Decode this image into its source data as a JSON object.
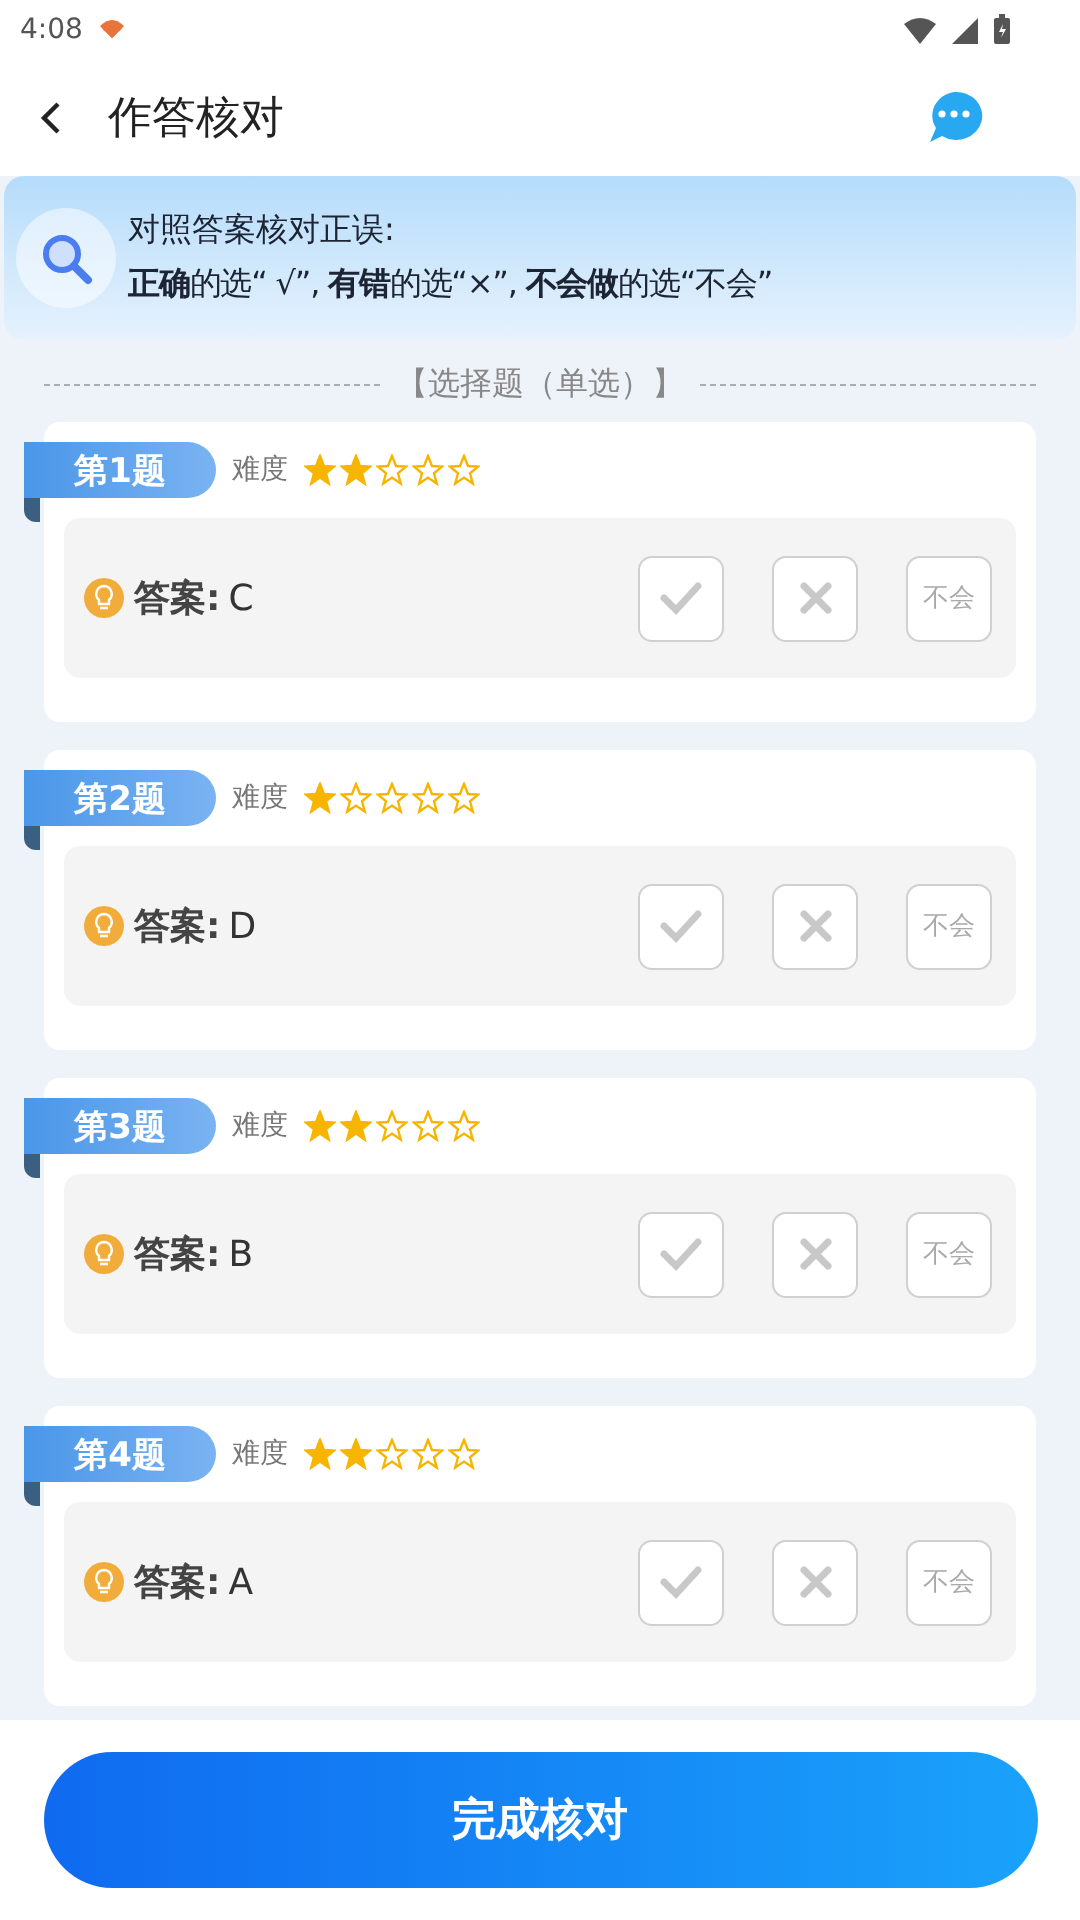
{
  "status_bar": {
    "time": "4:08"
  },
  "header": {
    "title": "作答核对"
  },
  "notice": {
    "title": "对照答案核对正误:",
    "text": "**正确**的选“ √”, **有错**的选“×”, **不会做**的选“不会”"
  },
  "section": {
    "title": "【选择题（单选）】"
  },
  "questions": [
    {
      "label": "第1题",
      "difficulty_label": "难度",
      "stars": 2,
      "answer_label": "答案:",
      "answer": "C",
      "choices": [
        {
          "kind": "correct",
          "selected": false
        },
        {
          "kind": "wrong",
          "selected": false
        },
        {
          "kind": "unknown",
          "label": "不会",
          "selected": false
        }
      ]
    },
    {
      "label": "第2题",
      "difficulty_label": "难度",
      "stars": 1,
      "answer_label": "答案:",
      "answer": "D",
      "choices": [
        {
          "kind": "correct",
          "selected": false
        },
        {
          "kind": "wrong",
          "selected": false
        },
        {
          "kind": "unknown",
          "label": "不会",
          "selected": false
        }
      ]
    },
    {
      "label": "第3题",
      "difficulty_label": "难度",
      "stars": 2,
      "answer_label": "答案:",
      "answer": "B",
      "choices": [
        {
          "kind": "correct",
          "selected": false
        },
        {
          "kind": "wrong",
          "selected": false
        },
        {
          "kind": "unknown",
          "label": "不会",
          "selected": false
        }
      ]
    },
    {
      "label": "第4题",
      "difficulty_label": "难度",
      "stars": 2,
      "answer_label": "答案:",
      "answer": "A",
      "choices": [
        {
          "kind": "correct",
          "selected": false
        },
        {
          "kind": "wrong",
          "selected": false
        },
        {
          "kind": "unknown",
          "label": "不会",
          "selected": false
        }
      ]
    }
  ],
  "footer": {
    "button": "完成核对"
  }
}
